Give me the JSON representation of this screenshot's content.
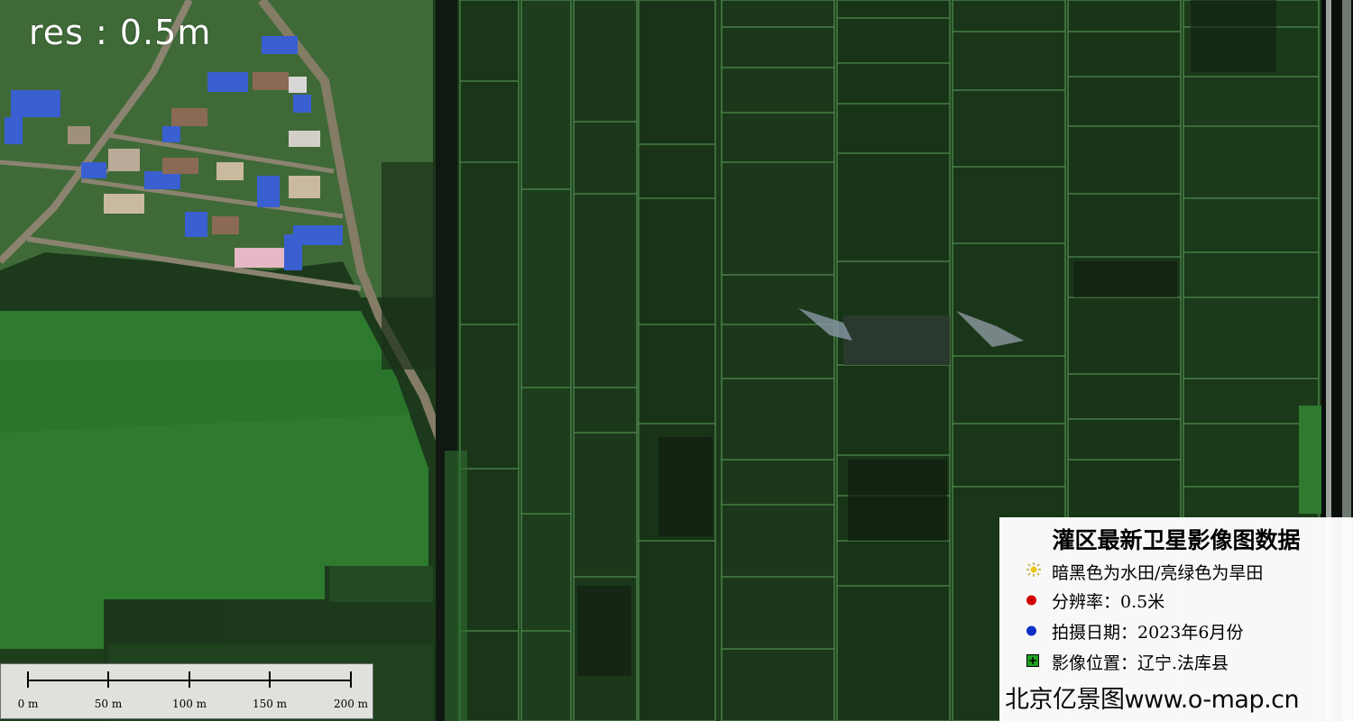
{
  "map": {
    "resolution_label": "res : 0.5m"
  },
  "scale_bar": {
    "labels": [
      "0 m",
      "50 m",
      "100 m",
      "150 m",
      "200 m"
    ]
  },
  "legend": {
    "title": "灌区最新卫星影像图数据",
    "items": [
      {
        "text": "暗黑色为水田/亮绿色为旱田",
        "icon": "sun-icon",
        "color": "#f0c419"
      },
      {
        "text": "分辨率：0.5米",
        "icon": "red-dot-icon",
        "color": "#d40000"
      },
      {
        "text": "拍摄日期：2023年6月份",
        "icon": "blue-dot-icon",
        "color": "#1030c8"
      },
      {
        "text": "影像位置：辽宁.法库县",
        "icon": "green-plus-box-icon",
        "color": "#1fa31f"
      }
    ],
    "credit": "北京亿景图www.o-map.cn"
  },
  "colors": {
    "dark_paddy": "#1a3519",
    "bright_field": "#2f7a30",
    "blue_roof": "#3d64d4",
    "canal": "#0e1410"
  }
}
